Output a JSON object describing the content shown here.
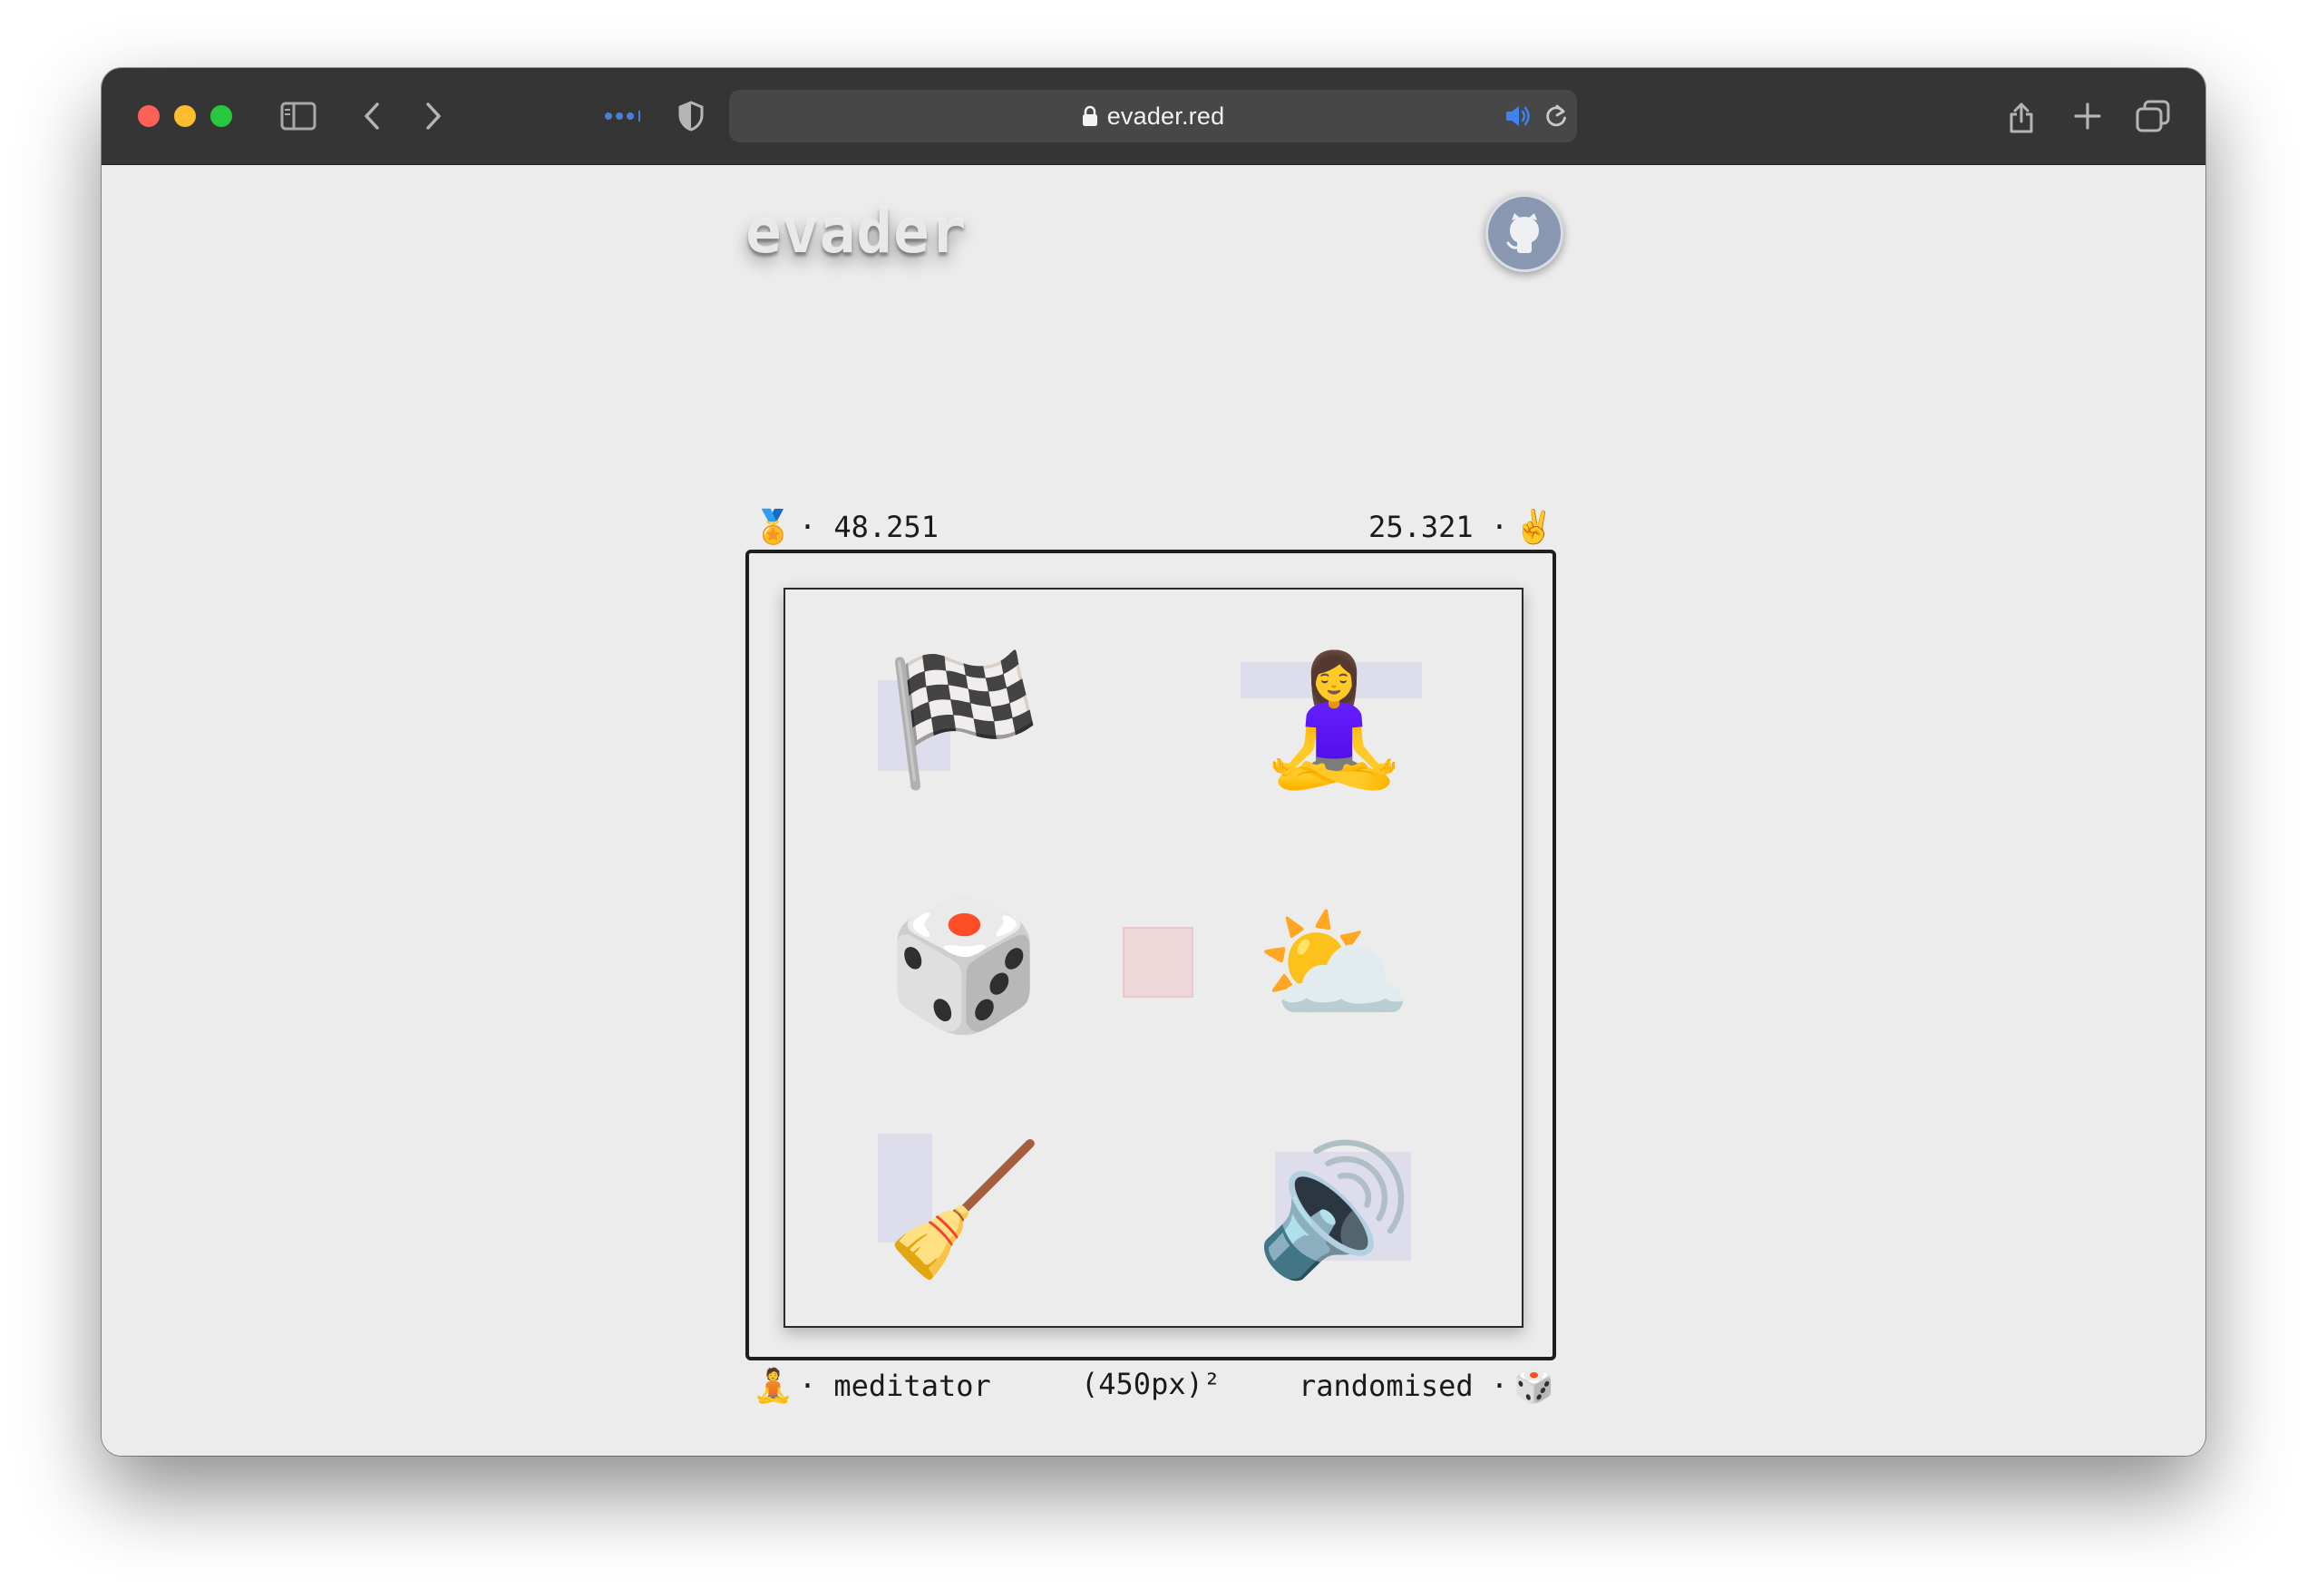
{
  "browser": {
    "url": "evader.red"
  },
  "page": {
    "logo": "evader"
  },
  "stats": {
    "top_left": {
      "icon": "medal-icon",
      "glyph": "🏅",
      "value": "· 48.251"
    },
    "top_right": {
      "icon": "victory-hand-icon",
      "glyph": "✌️",
      "value": "25.321 ·"
    },
    "bottom_left": {
      "icon": "meditator-icon",
      "glyph": "🧘",
      "value": "· meditator"
    },
    "bottom_middle": {
      "value": "(450px)²"
    },
    "bottom_right": {
      "icon": "dice-icon",
      "glyph": "🎲",
      "value": "randomised ·"
    }
  },
  "arena": {
    "tiles": [
      {
        "name": "chequered-flag-icon",
        "glyph": "🏁"
      },
      {
        "name": "meditating-woman-icon",
        "glyph": "🧘‍♀️"
      },
      {
        "name": "dice-icon",
        "glyph": "🎲"
      },
      {
        "name": "sun-behind-cloud-icon",
        "glyph": "⛅"
      },
      {
        "name": "broom-icon",
        "glyph": "🧹"
      },
      {
        "name": "speaker-icon",
        "glyph": "🔊"
      }
    ]
  }
}
